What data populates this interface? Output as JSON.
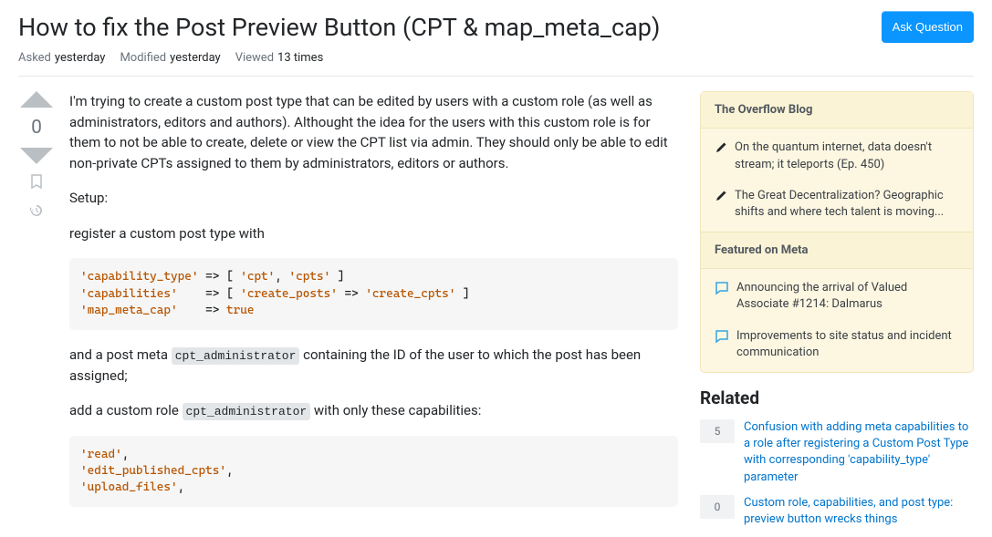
{
  "header": {
    "title": "How to fix the Post Preview Button (CPT & map_meta_cap)",
    "ask_button": "Ask Question"
  },
  "meta": {
    "asked_label": "Asked",
    "asked_value": "yesterday",
    "modified_label": "Modified",
    "modified_value": "yesterday",
    "viewed_label": "Viewed",
    "viewed_value": "13 times"
  },
  "vote": {
    "count": "0"
  },
  "body": {
    "p1": "I'm trying to create a custom post type that can be edited by users with a custom role (as well as administrators, editors and authors). Althought the idea for the users with this custom role is for them to not be able to create, delete or view the CPT list via admin. They should only be able to edit non-private CPTs assigned to them by administrators, editors or authors.",
    "p2": "Setup:",
    "p3": "register a custom post type with",
    "code1_inline": "cpt_administrator",
    "p4a": "and a post meta ",
    "p4b": " containing the ID of the user to which the post has been assigned;",
    "p5a": "add a custom role ",
    "code2_inline": "cpt_administrator",
    "p5b": " with only these capabilities:"
  },
  "sidebar": {
    "overflow_title": "The Overflow Blog",
    "overflow_items": [
      "On the quantum internet, data doesn't stream; it teleports (Ep. 450)",
      "The Great Decentralization? Geographic shifts and where tech talent is moving..."
    ],
    "featured_title": "Featured on Meta",
    "featured_items": [
      "Announcing the arrival of Valued Associate #1214: Dalmarus",
      "Improvements to site status and incident communication"
    ],
    "related_title": "Related",
    "related": [
      {
        "score": "5",
        "title": "Confusion with adding meta capabilities to a role after registering a Custom Post Type with corresponding 'capability_type' parameter"
      },
      {
        "score": "0",
        "title": "Custom role, capabilities, and post type: preview button wrecks things"
      }
    ]
  }
}
